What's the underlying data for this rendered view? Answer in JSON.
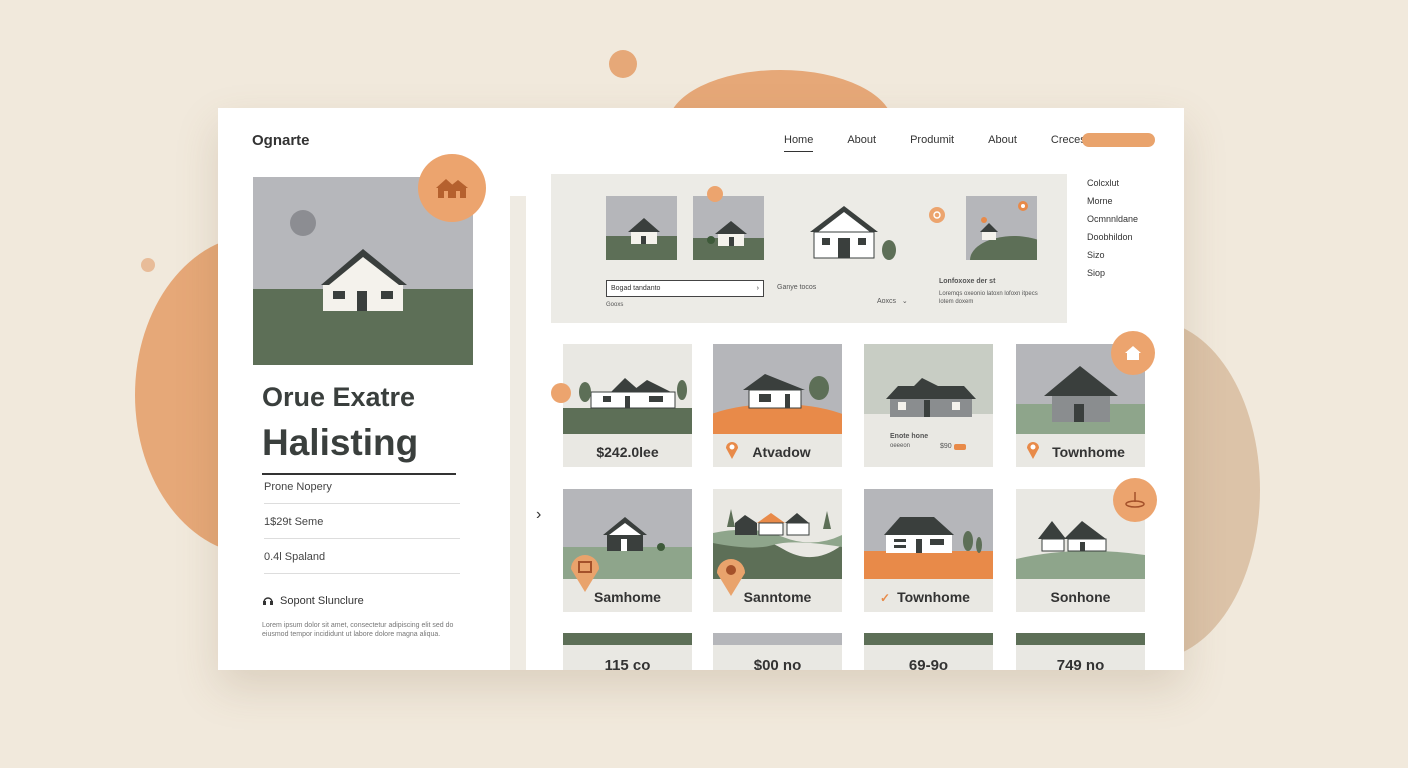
{
  "brand": "Ognarte",
  "nav": [
    "Home",
    "About",
    "Produmit",
    "About",
    "Creces"
  ],
  "hero": {
    "title_line1": "Orue Exatre",
    "title_line2": "Halisting",
    "meta": [
      "Prone Nopery",
      "1$29t Seme",
      "0.4l Spaland"
    ],
    "support": "Sopont Slunclure",
    "small_text": "Lorem ipsum dolor sit amet, consectetur adipiscing elit sed do eiusmod tempor incididunt ut labore dolore magna aliqua."
  },
  "feature": {
    "search_placeholder": "Bogad tandanto",
    "mini_label": "Ganye tocos",
    "sub_label": "Gooxs",
    "select_label": "Aoxcs",
    "caption_title": "Lonfoxoxe der st",
    "caption_text": "Loremqs oxeonio latoxn lofoxn itpecs lotem doxem"
  },
  "side_menu": [
    "Colcxlut",
    "Morne",
    "Ocmnnldane",
    "Doobhildon",
    "Sizo",
    "Siop"
  ],
  "cards": [
    {
      "label": "$242.0lee"
    },
    {
      "label": "Atvadow"
    },
    {
      "label": "",
      "small_title": "Enote hone",
      "small_sub": "oeeeon",
      "small_price": "$90"
    },
    {
      "label": "Townhome"
    },
    {
      "label": "Samhome"
    },
    {
      "label": "Sanntome"
    },
    {
      "label": "Townhome"
    },
    {
      "label": "Sonhone"
    }
  ],
  "prices": [
    "115 co",
    "$00 no",
    "69-9o",
    "749 no"
  ],
  "colors": {
    "accent": "#eca46e",
    "green": "#5d6f57",
    "gray": "#b5b6ba",
    "orange_land": "#e88a49"
  }
}
